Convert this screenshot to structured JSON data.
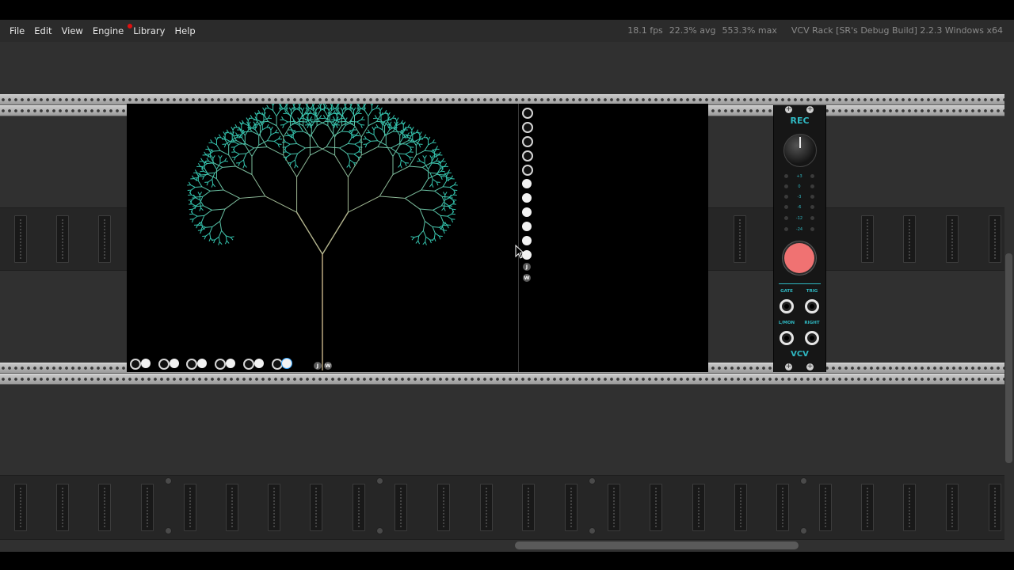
{
  "menu": {
    "items": [
      {
        "label": "File"
      },
      {
        "label": "Edit"
      },
      {
        "label": "View"
      },
      {
        "label": "Engine"
      },
      {
        "label": "Library",
        "has_notification": true
      },
      {
        "label": "Help"
      }
    ]
  },
  "status": {
    "fps": "18.1 fps",
    "avg": "22.3% avg",
    "max": "553.3% max",
    "version": "VCV Rack [SR's Debug Build] 2.2.3 Windows x64"
  },
  "recorder_module": {
    "title": "REC",
    "level_labels": [
      "+3",
      "0",
      "-3",
      "-6",
      "-12",
      "-24"
    ],
    "jack_labels": {
      "gate": "GATE",
      "trig": "TRIG",
      "left": "L/MON",
      "right": "RIGHT"
    },
    "brand": "VCV"
  },
  "fractal_module": {
    "port_letters": [
      "J",
      "W"
    ],
    "color_trunk": "#c8b48a",
    "color_leaves": "#35c6b0"
  },
  "colors": {
    "accent_teal": "#2fb8c2",
    "record_button": "#f07272",
    "notification_dot": "#e01010"
  }
}
